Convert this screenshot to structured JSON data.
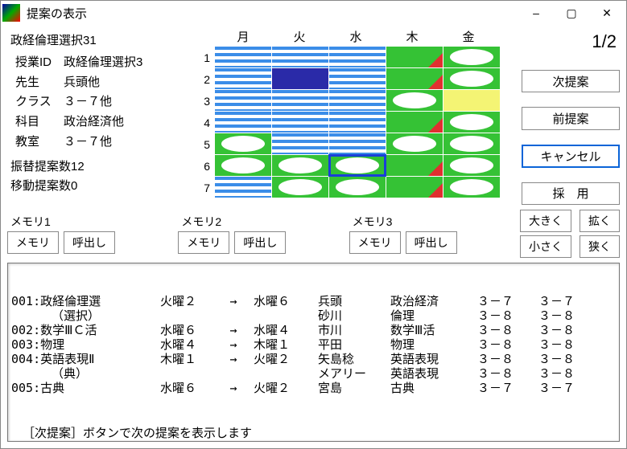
{
  "window": {
    "title": "提案の表示",
    "minimize": "–",
    "maximize": "▢",
    "close": "✕"
  },
  "info": {
    "header": "政経倫理選択31",
    "rows": [
      {
        "label": "授業ID",
        "value": "政経倫理選択3"
      },
      {
        "label": "先生",
        "value": "兵頭他"
      },
      {
        "label": "クラス",
        "value": "３－７他"
      },
      {
        "label": "科目",
        "value": "政治経済他"
      },
      {
        "label": "教室",
        "value": "３－７他"
      }
    ],
    "swap": "振替提案数12",
    "move": "移動提案数0"
  },
  "days": [
    "月",
    "火",
    "水",
    "木",
    "金"
  ],
  "grid": {
    "rowLabels": [
      "1",
      "2",
      "3",
      "4",
      "5",
      "6",
      "7"
    ],
    "cells": [
      [
        "stripes",
        "stripes",
        "stripes",
        "green-tri",
        "green oval"
      ],
      [
        "stripes",
        "navy",
        "stripes",
        "green-tri",
        "green oval"
      ],
      [
        "stripes",
        "stripes",
        "stripes",
        "green oval",
        "yellow"
      ],
      [
        "stripes",
        "stripes",
        "stripes",
        "green-tri",
        "green oval"
      ],
      [
        "green oval",
        "stripes",
        "stripes",
        "green oval",
        "green oval"
      ],
      [
        "green oval",
        "green oval",
        "green oval selected",
        "green-tri",
        "green oval"
      ],
      [
        "stripes",
        "green oval",
        "green oval",
        "green-tri",
        "green oval"
      ]
    ]
  },
  "page": "1/2",
  "buttons": {
    "next": "次提案",
    "prev": "前提案",
    "cancel": "キャンセル",
    "adopt": "採　用",
    "big": "大きく",
    "small": "小さく",
    "wide": "拡く",
    "narrow": "狭く"
  },
  "memory": {
    "groups": [
      {
        "title": "メモリ1",
        "save": "メモリ",
        "load": "呼出し"
      },
      {
        "title": "メモリ2",
        "save": "メモリ",
        "load": "呼出し"
      },
      {
        "title": "メモリ3",
        "save": "メモリ",
        "load": "呼出し"
      }
    ]
  },
  "list": {
    "rows": [
      {
        "id": "001:",
        "name": "政経倫理選",
        "from": "火曜２",
        "arrow": "→",
        "to": "水曜６",
        "teacher": "兵頭",
        "subject": "政治経済",
        "cls1": "３－７",
        "cls2": "３－７"
      },
      {
        "id": "",
        "name": "（選択）",
        "from": "",
        "arrow": "",
        "to": "",
        "teacher": "砂川",
        "subject": "倫理",
        "cls1": "３－８",
        "cls2": "３－８"
      },
      {
        "id": "002:",
        "name": "数学ⅢＣ活",
        "from": "水曜６",
        "arrow": "→",
        "to": "水曜４",
        "teacher": "市川",
        "subject": "数学Ⅲ活",
        "cls1": "３－８",
        "cls2": "３－８"
      },
      {
        "id": "003:",
        "name": "物理",
        "from": "水曜４",
        "arrow": "→",
        "to": "木曜１",
        "teacher": "平田",
        "subject": "物理",
        "cls1": "３－８",
        "cls2": "３－８"
      },
      {
        "id": "004:",
        "name": "英語表現Ⅱ",
        "from": "木曜１",
        "arrow": "→",
        "to": "火曜２",
        "teacher": "矢島稔",
        "subject": "英語表現",
        "cls1": "３－８",
        "cls2": "３－８"
      },
      {
        "id": "",
        "name": "（典）",
        "from": "",
        "arrow": "",
        "to": "",
        "teacher": "メアリー",
        "subject": "英語表現",
        "cls1": "３－８",
        "cls2": "３－８"
      },
      {
        "id": "005:",
        "name": "古典",
        "from": "水曜６",
        "arrow": "→",
        "to": "火曜２",
        "teacher": "宮島",
        "subject": "古典",
        "cls1": "３－７",
        "cls2": "３－７"
      }
    ],
    "footer": "［次提案］ボタンで次の提案を表示します"
  }
}
